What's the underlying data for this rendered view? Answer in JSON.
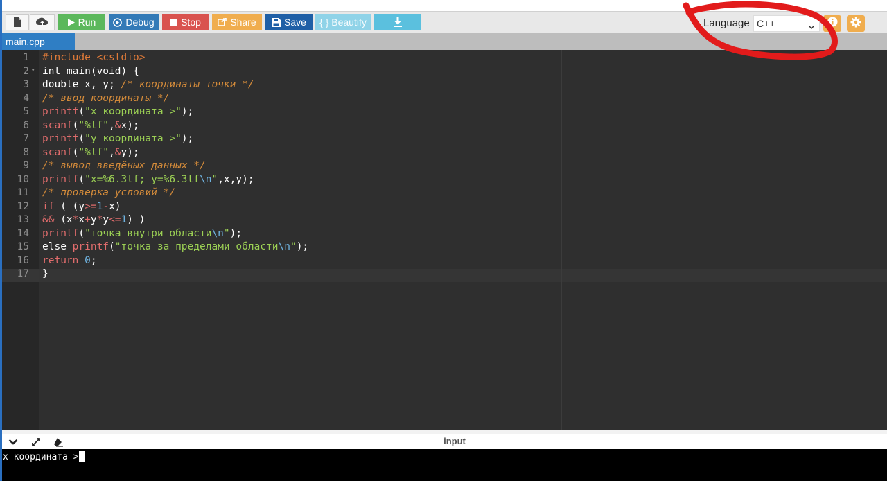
{
  "toolbar": {
    "run_label": "Run",
    "debug_label": "Debug",
    "stop_label": "Stop",
    "share_label": "Share",
    "save_label": "Save",
    "beautify_label": "{ } Beautify",
    "language_label": "Language",
    "language_value": "C++"
  },
  "tabs": [
    {
      "label": "main.cpp"
    }
  ],
  "editor": {
    "line_numbers": [
      "1",
      "2",
      "3",
      "4",
      "5",
      "6",
      "7",
      "8",
      "9",
      "10",
      "11",
      "12",
      "13",
      "14",
      "15",
      "16",
      "17"
    ]
  },
  "console": {
    "title": "input",
    "output": "x координата >"
  },
  "colors": {
    "run": "#5cb85c",
    "debug": "#337ab7",
    "stop": "#d9534f",
    "share": "#f0ad4e",
    "save": "#1f5fa6",
    "beautify": "#5bc0de",
    "annotation": "#e21b1b"
  }
}
